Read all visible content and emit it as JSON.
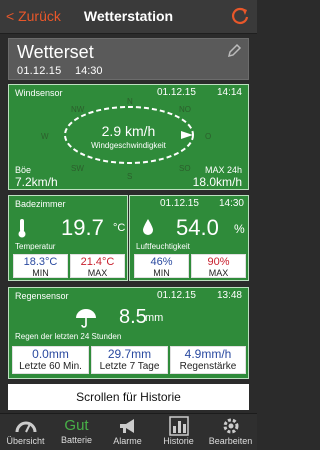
{
  "nav": {
    "back_label": "< Zurück",
    "title": "Wetterstation"
  },
  "station": {
    "name": "Wetterset",
    "date": "01.12.15",
    "time": "14:30"
  },
  "wind": {
    "label": "Windsensor",
    "date": "01.12.15",
    "time": "14:14",
    "value": "2.9 km/h",
    "sublabel": "Windgeschwindigkeit",
    "directions": [
      "N",
      "NO",
      "O",
      "SO",
      "S",
      "SW",
      "W",
      "NW"
    ],
    "gust_label": "Böe",
    "gust_value": "7.2km/h",
    "max_label": "MAX 24h",
    "max_value": "18.0km/h"
  },
  "temperature": {
    "label": "Badezimmer",
    "value": "19.7",
    "unit": "°C",
    "sublabel": "Temperatur",
    "min_value": "18.3°C",
    "min_label": "MIN",
    "max_value": "21.4°C",
    "max_label": "MAX"
  },
  "humidity": {
    "date": "01.12.15",
    "time": "14:30",
    "value": "54.0",
    "unit": "%",
    "sublabel": "Luftfeuchtigkeit",
    "min_value": "46%",
    "min_label": "MIN",
    "max_value": "90%",
    "max_label": "MAX"
  },
  "rain": {
    "label": "Regensensor",
    "date": "01.12.15",
    "time": "13:48",
    "value": "8.5",
    "unit": "mm",
    "sublabel": "Regen der letzten 24 Stunden",
    "boxes": [
      {
        "value": "0.0mm",
        "label": "Letzte 60 Min."
      },
      {
        "value": "29.7mm",
        "label": "Letzte 7 Tage"
      },
      {
        "value": "4.9mm/h",
        "label": "Regenstärke"
      }
    ]
  },
  "history_button": "Scrollen für Historie",
  "tabs": [
    {
      "label": "Übersicht",
      "icon": "gauge-icon"
    },
    {
      "label": "Batterie",
      "status": "Gut",
      "icon": "battery-status"
    },
    {
      "label": "Alarme",
      "icon": "megaphone-icon"
    },
    {
      "label": "Historie",
      "icon": "bar-chart-icon"
    },
    {
      "label": "Bearbeiten",
      "icon": "gear-icon"
    }
  ],
  "colors": {
    "panel_green": "#2f8b3a",
    "accent_orange": "#e8572a",
    "value_blue": "#2a4aa0",
    "value_red": "#c8202e"
  }
}
